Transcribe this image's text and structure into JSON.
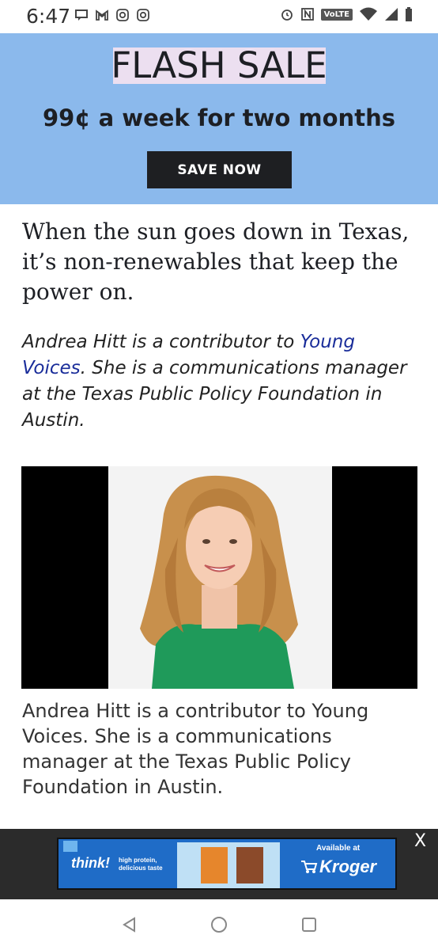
{
  "status_bar": {
    "time": "6:47",
    "volte": "VoLTE",
    "icons_left": [
      "message-icon",
      "gmail-icon",
      "instagram-icon",
      "instagram-icon"
    ],
    "icons_right": [
      "alarm-icon",
      "nfc-icon",
      "volte-icon",
      "wifi-icon",
      "signal-icon",
      "battery-icon"
    ]
  },
  "banner": {
    "headline": "FLASH SALE",
    "subline": "99¢ a week for two months",
    "button_label": "SAVE NOW",
    "background": "#8bb9ec",
    "highlight": "#ecdff0"
  },
  "article": {
    "lead": "When the sun goes down in Texas, it’s non-renewables that keep the power on.",
    "byline_pre": "Andrea Hitt is a contributor to ",
    "byline_link": "Young Voices",
    "byline_post": ". She is a communications manager at the Texas Public Policy Foundation in Austin.",
    "caption": "Andrea Hitt is a contributor to Young Voices. She is a communications manager at the Texas Public Policy Foundation in Austin."
  },
  "ad": {
    "brand": "think!",
    "tagline": "high protein, delicious taste",
    "available": "Available at",
    "retailer": "Kroger",
    "close_label": "X"
  },
  "nav": {
    "icons": [
      "back-icon",
      "home-icon",
      "recents-icon"
    ]
  }
}
